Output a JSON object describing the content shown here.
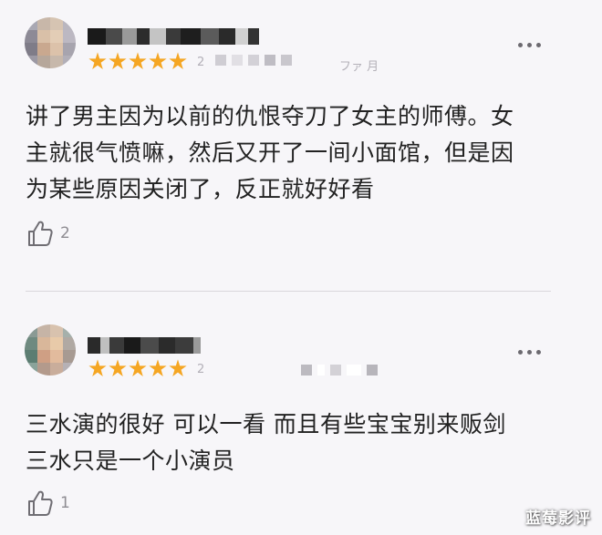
{
  "reviews": [
    {
      "date_fragment": "2",
      "date_tail": "ファ 月",
      "content_lines": [
        "讲了男主因为以前的仇恨夺刀了女主的师傅。女",
        "主就很气愤嘛，然后又开了一间小面馆，但是因",
        "为某些原因关闭了，反正就好好看"
      ],
      "likes": "2",
      "rating": 5
    },
    {
      "date_fragment": "2",
      "content_lines": [
        "三水演的很好 可以一看 而且有些宝宝别来贩剑",
        "三水只是一个小演员"
      ],
      "likes": "1",
      "rating": 5
    }
  ],
  "colors": {
    "star": "#f5a623",
    "background": "#f7f6f9",
    "text": "#222222",
    "muted": "#8e8c92"
  },
  "icons": {
    "like": "thumbs-up-icon",
    "more": "more-horizontal-icon",
    "star": "star-icon"
  },
  "watermark": "蓝莓影评"
}
